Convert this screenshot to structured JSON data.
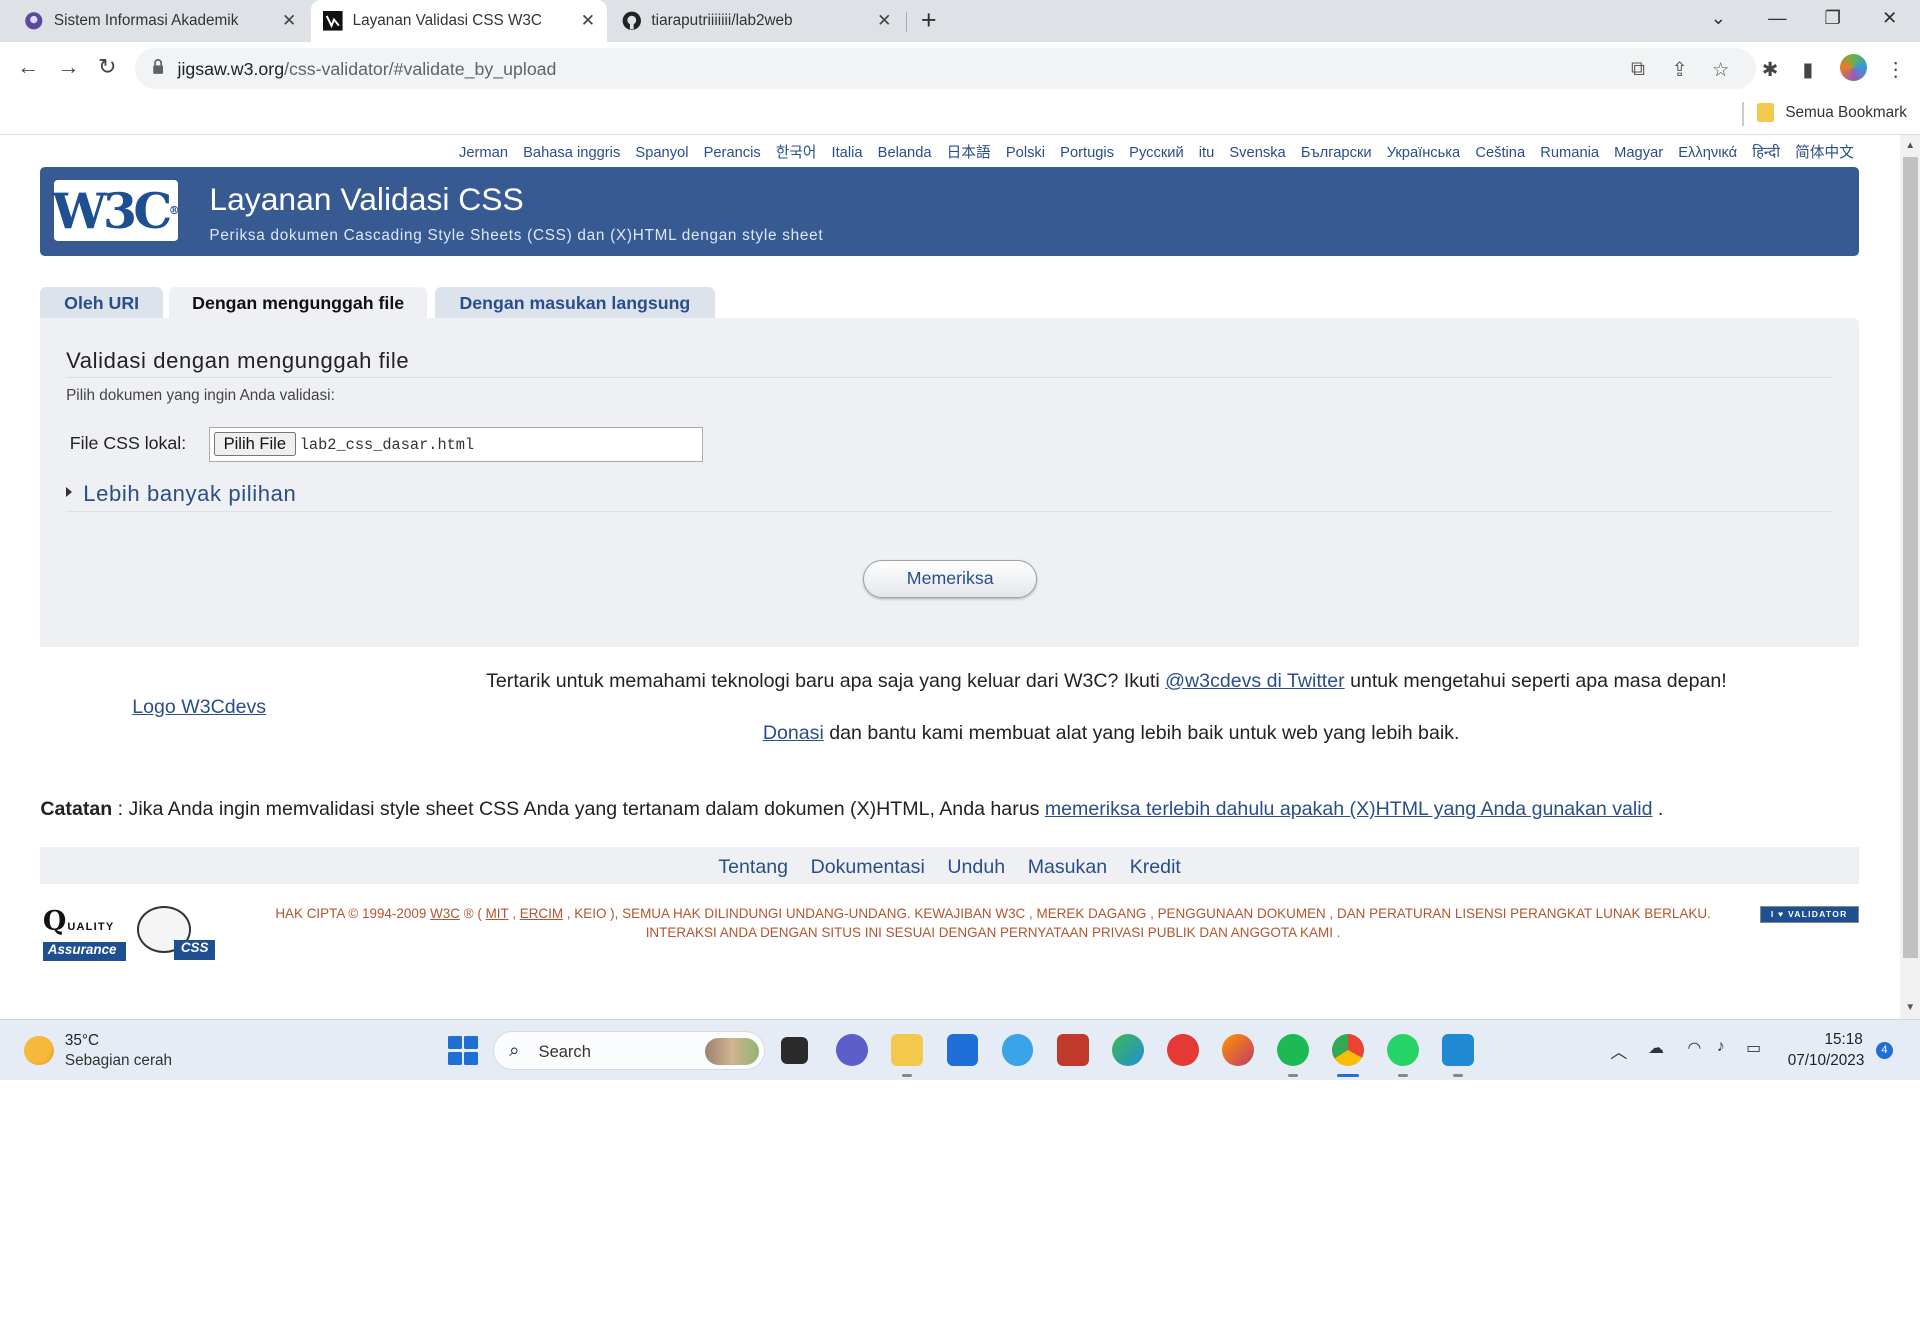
{
  "browser": {
    "tabs": [
      {
        "title": "Sistem Informasi Akademik",
        "close": "✕"
      },
      {
        "title": "Layanan Validasi CSS W3C",
        "close": "✕"
      },
      {
        "title": "tiaraputriiiiiii/lab2web",
        "close": "✕"
      }
    ],
    "new_tab": "+",
    "url_host": "jigsaw.w3.org",
    "url_path": "/css-validator/#validate_by_upload",
    "bookmark_folder": "Semua Bookmark",
    "colors": {
      "tabstrip": "#dee1e6",
      "omnibox": "#f1f3f4"
    }
  },
  "page": {
    "languages": [
      "Jerman",
      "Bahasa inggris",
      "Spanyol",
      "Perancis",
      "한국어",
      "Italia",
      "Belanda",
      "日本語",
      "Polski",
      "Portugis",
      "Русский",
      "itu",
      "Svenska",
      "Български",
      "Українська",
      "Ceština",
      "Rumania",
      "Magyar",
      "Ελληνικά",
      "हिन्दी",
      "简体中文"
    ],
    "banner": {
      "logo_text": "W3C",
      "title": "Layanan Validasi CSS",
      "subtitle": "Periksa dokumen Cascading Style Sheets (CSS) dan (X)HTML dengan style sheet",
      "color": "#385a92"
    },
    "tabs": [
      "Oleh URI",
      "Dengan mengunggah file",
      "Dengan masukan langsung"
    ],
    "form": {
      "heading": "Validasi dengan mengunggah file",
      "instruction": "Pilih dokumen yang ingin Anda validasi:",
      "file_label": "File CSS lokal:",
      "choose_button": "Pilih File",
      "file_name": "lab2_css_dasar.html",
      "more_options": "Lebih banyak pilihan",
      "submit": "Memeriksa"
    },
    "promo": {
      "logo_alt": "Logo W3Cdevs",
      "twitter_prefix": "Tertarik untuk memahami teknologi baru apa saja yang keluar dari W3C? Ikuti ",
      "twitter_link": "@w3cdevs di Twitter",
      "twitter_suffix": " untuk mengetahui seperti apa masa depan!",
      "donate_link": "Donasi",
      "donate_suffix": " dan bantu kami membuat alat yang lebih baik untuk web yang lebih baik."
    },
    "note": {
      "label": "Catatan",
      "text": " : Jika Anda ingin memvalidasi style sheet CSS Anda yang tertanam dalam dokumen (X)HTML, Anda harus ",
      "link": "memeriksa terlebih dahulu apakah (X)HTML yang Anda gunakan valid",
      "end": " ."
    },
    "footer_nav": [
      "Tentang",
      "Dokumentasi",
      "Unduh",
      "Masukan",
      "Kredit"
    ],
    "badges": {
      "qa_q": "Q",
      "qa_quality": "UALITY",
      "qa_assurance": "Assurance",
      "css_label": "CSS",
      "validator": "I ♥ VALIDATOR"
    },
    "copyright": {
      "p1": "HAK CIPTA © 1994-2009 ",
      "w3c": "W3C",
      "p2": " ® ( ",
      "mit": "MIT",
      "sep1": " , ",
      "ercim": "ERCIM",
      "p3": " , KEIO ), SEMUA HAK DILINDUNGI UNDANG-UNDANG. KEWAJIBAN W3C , MEREK DAGANG , PENGGUNAAN DOKUMEN , DAN PERATURAN LISENSI PERANGKAT LUNAK BERLAKU. INTERAKSI ANDA DENGAN SITUS INI SESUAI DENGAN PERNYATAAN PRIVASI PUBLIK DAN ANGGOTA KAMI ."
    }
  },
  "taskbar": {
    "temperature": "35°C",
    "weather": "Sebagian cerah",
    "search_label": "Search",
    "time": "15:18",
    "date": "07/10/2023",
    "notifications": "4"
  }
}
